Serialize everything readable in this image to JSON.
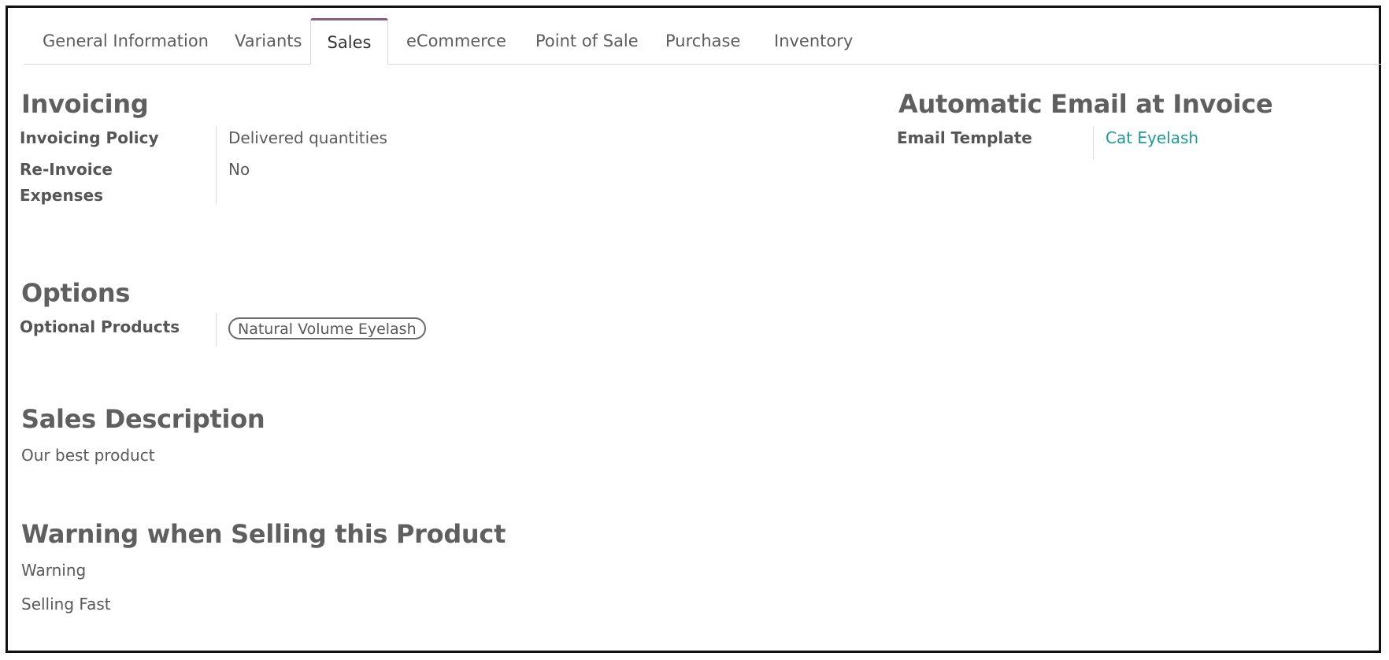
{
  "tabs": [
    {
      "label": "General Information"
    },
    {
      "label": "Variants"
    },
    {
      "label": "Sales"
    },
    {
      "label": "eCommerce"
    },
    {
      "label": "Point of Sale"
    },
    {
      "label": "Purchase"
    },
    {
      "label": "Inventory"
    }
  ],
  "active_tab": "Sales",
  "invoicing": {
    "title": "Invoicing",
    "policy_label": "Invoicing Policy",
    "policy_value": "Delivered quantities",
    "reinvoice_label_line1": "Re-Invoice",
    "reinvoice_label_line2": "Expenses",
    "reinvoice_value": "No"
  },
  "auto_email": {
    "title": "Automatic Email at Invoice",
    "template_label": "Email Template",
    "template_value": "Cat Eyelash"
  },
  "options": {
    "title": "Options",
    "optional_products_label": "Optional Products",
    "optional_products": [
      "Natural Volume Eyelash"
    ]
  },
  "sales_description": {
    "title": "Sales Description",
    "text": "Our best product"
  },
  "warning": {
    "title": "Warning when Selling this Product",
    "field_label": "Warning",
    "message": "Selling Fast"
  },
  "colors": {
    "accent": "#8b5e7e",
    "link": "#1f9a92"
  }
}
